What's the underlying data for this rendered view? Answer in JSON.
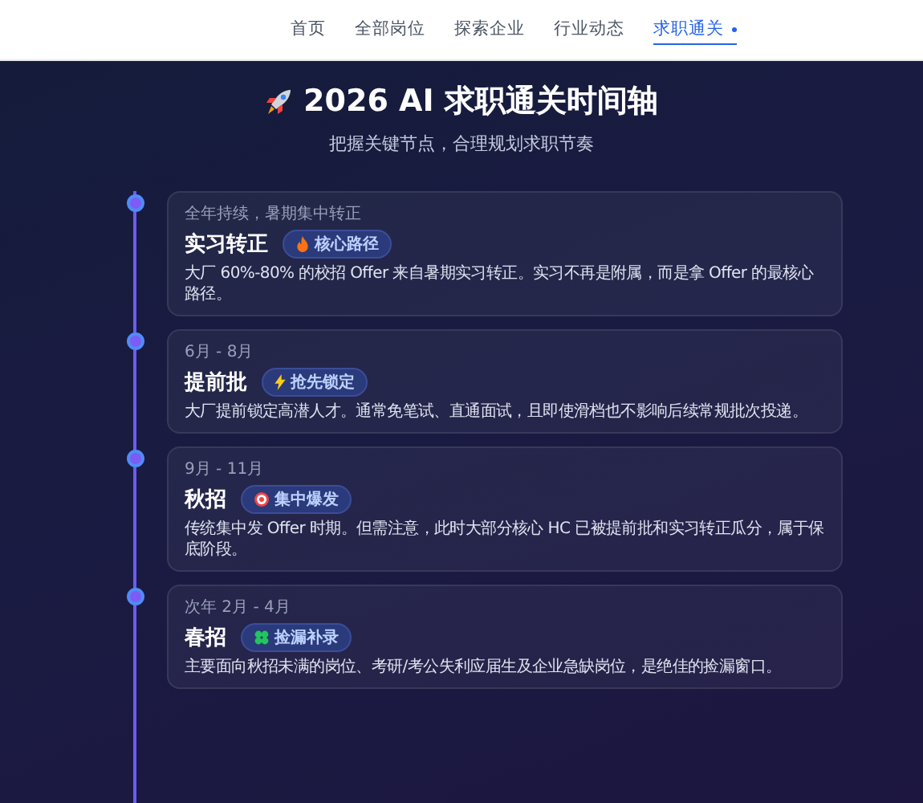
{
  "nav": [
    {
      "label": "首页",
      "selected": false
    },
    {
      "label": "全部岗位",
      "selected": false
    },
    {
      "label": "探索企业",
      "selected": false
    },
    {
      "label": "行业动态",
      "selected": false
    },
    {
      "label": "求职通关",
      "selected": true
    }
  ],
  "hero": {
    "title": "2026 AI 求职通关时间轴",
    "subtitle": "把握关键节点，合理规划求职节奏"
  },
  "timeline": [
    {
      "period": "全年持续，暑期集中转正",
      "title": "实习转正",
      "badge": {
        "kind": "fire",
        "label": "核心路径"
      },
      "description": "大厂 60%-80% 的校招 Offer 来自暑期实习转正。实习不再是附属，而是拿 Offer 的最核心路径。"
    },
    {
      "period": "6月 - 8月",
      "title": "提前批",
      "badge": {
        "kind": "bolt",
        "label": "抢先锁定"
      },
      "description": "大厂提前锁定高潜人才。通常免笔试、直通面试，且即使滑档也不影响后续常规批次投递。"
    },
    {
      "period": "9月 - 11月",
      "title": "秋招",
      "badge": {
        "kind": "target",
        "label": "集中爆发"
      },
      "description": "传统集中发 Offer 时期。但需注意，此时大部分核心 HC 已被提前批和实习转正瓜分，属于保底阶段。"
    },
    {
      "period": "次年 2月 - 4月",
      "title": "春招",
      "badge": {
        "kind": "clover",
        "label": "捡漏补录"
      },
      "description": "主要面向秋招未满的岗位、考研/考公失利应届生及企业急缺岗位，是绝佳的捡漏窗口。"
    }
  ]
}
